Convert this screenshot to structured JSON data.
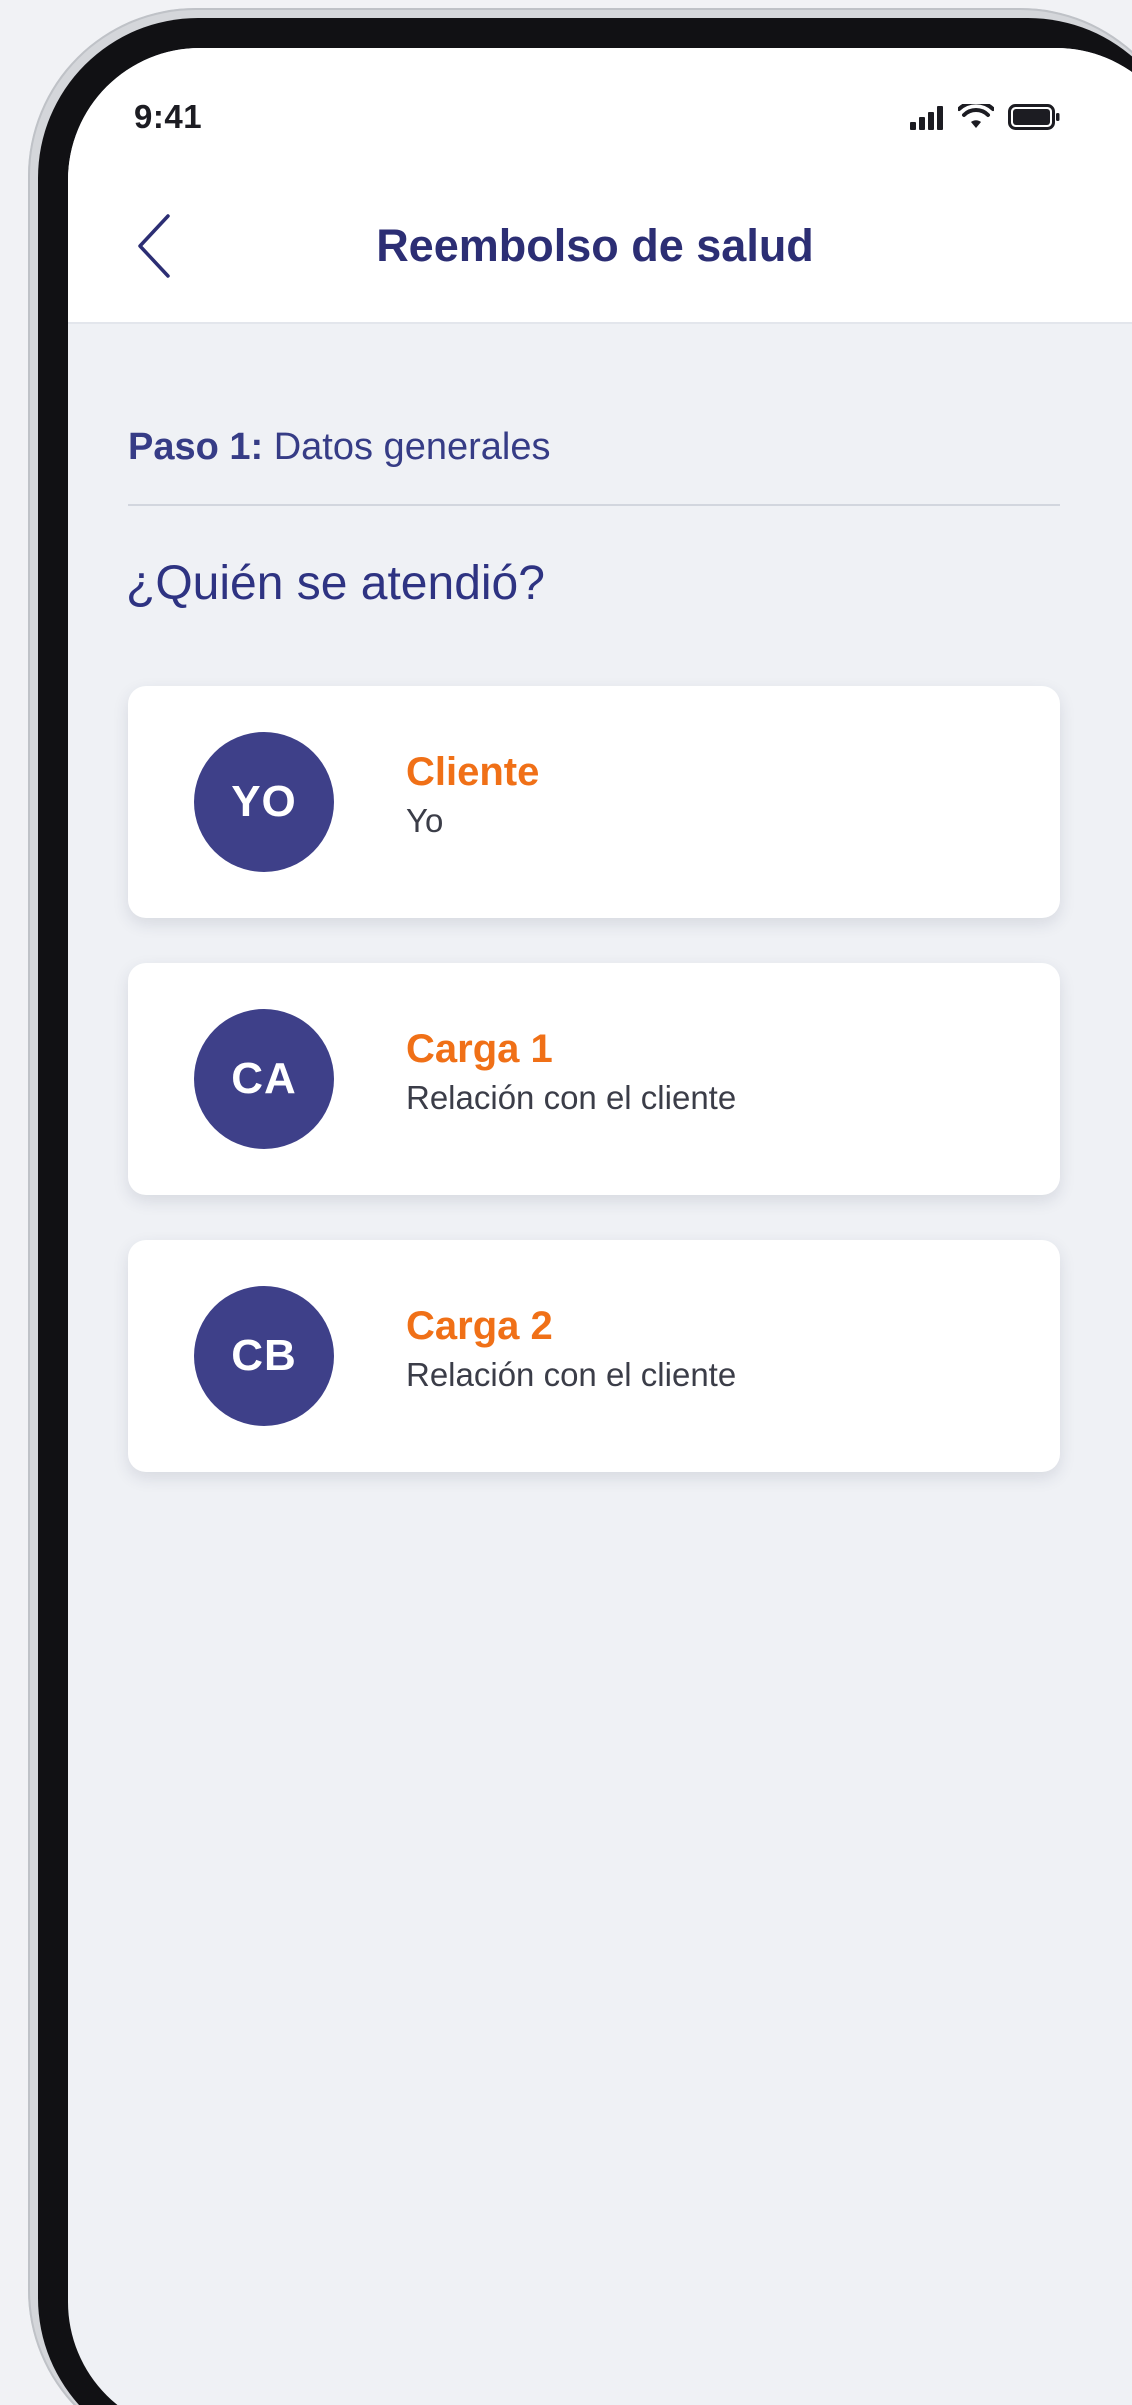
{
  "status_bar": {
    "time": "9:41",
    "icons": [
      "signal-icon",
      "wifi-icon",
      "battery-icon"
    ]
  },
  "header": {
    "back_icon": "chevron-left-icon",
    "title": "Reembolso de salud"
  },
  "step": {
    "label": "Paso 1:",
    "name": "Datos generales"
  },
  "question": "¿Quién se atendió?",
  "options": [
    {
      "initials": "YO",
      "title": "Cliente",
      "subtitle": "Yo"
    },
    {
      "initials": "CA",
      "title": "Carga 1",
      "subtitle": "Relación con el cliente"
    },
    {
      "initials": "CB",
      "title": "Carga 2",
      "subtitle": "Relación con el cliente"
    }
  ],
  "colors": {
    "brand_navy": "#3e4089",
    "accent_orange": "#f07017",
    "title_navy": "#2c2e74"
  }
}
